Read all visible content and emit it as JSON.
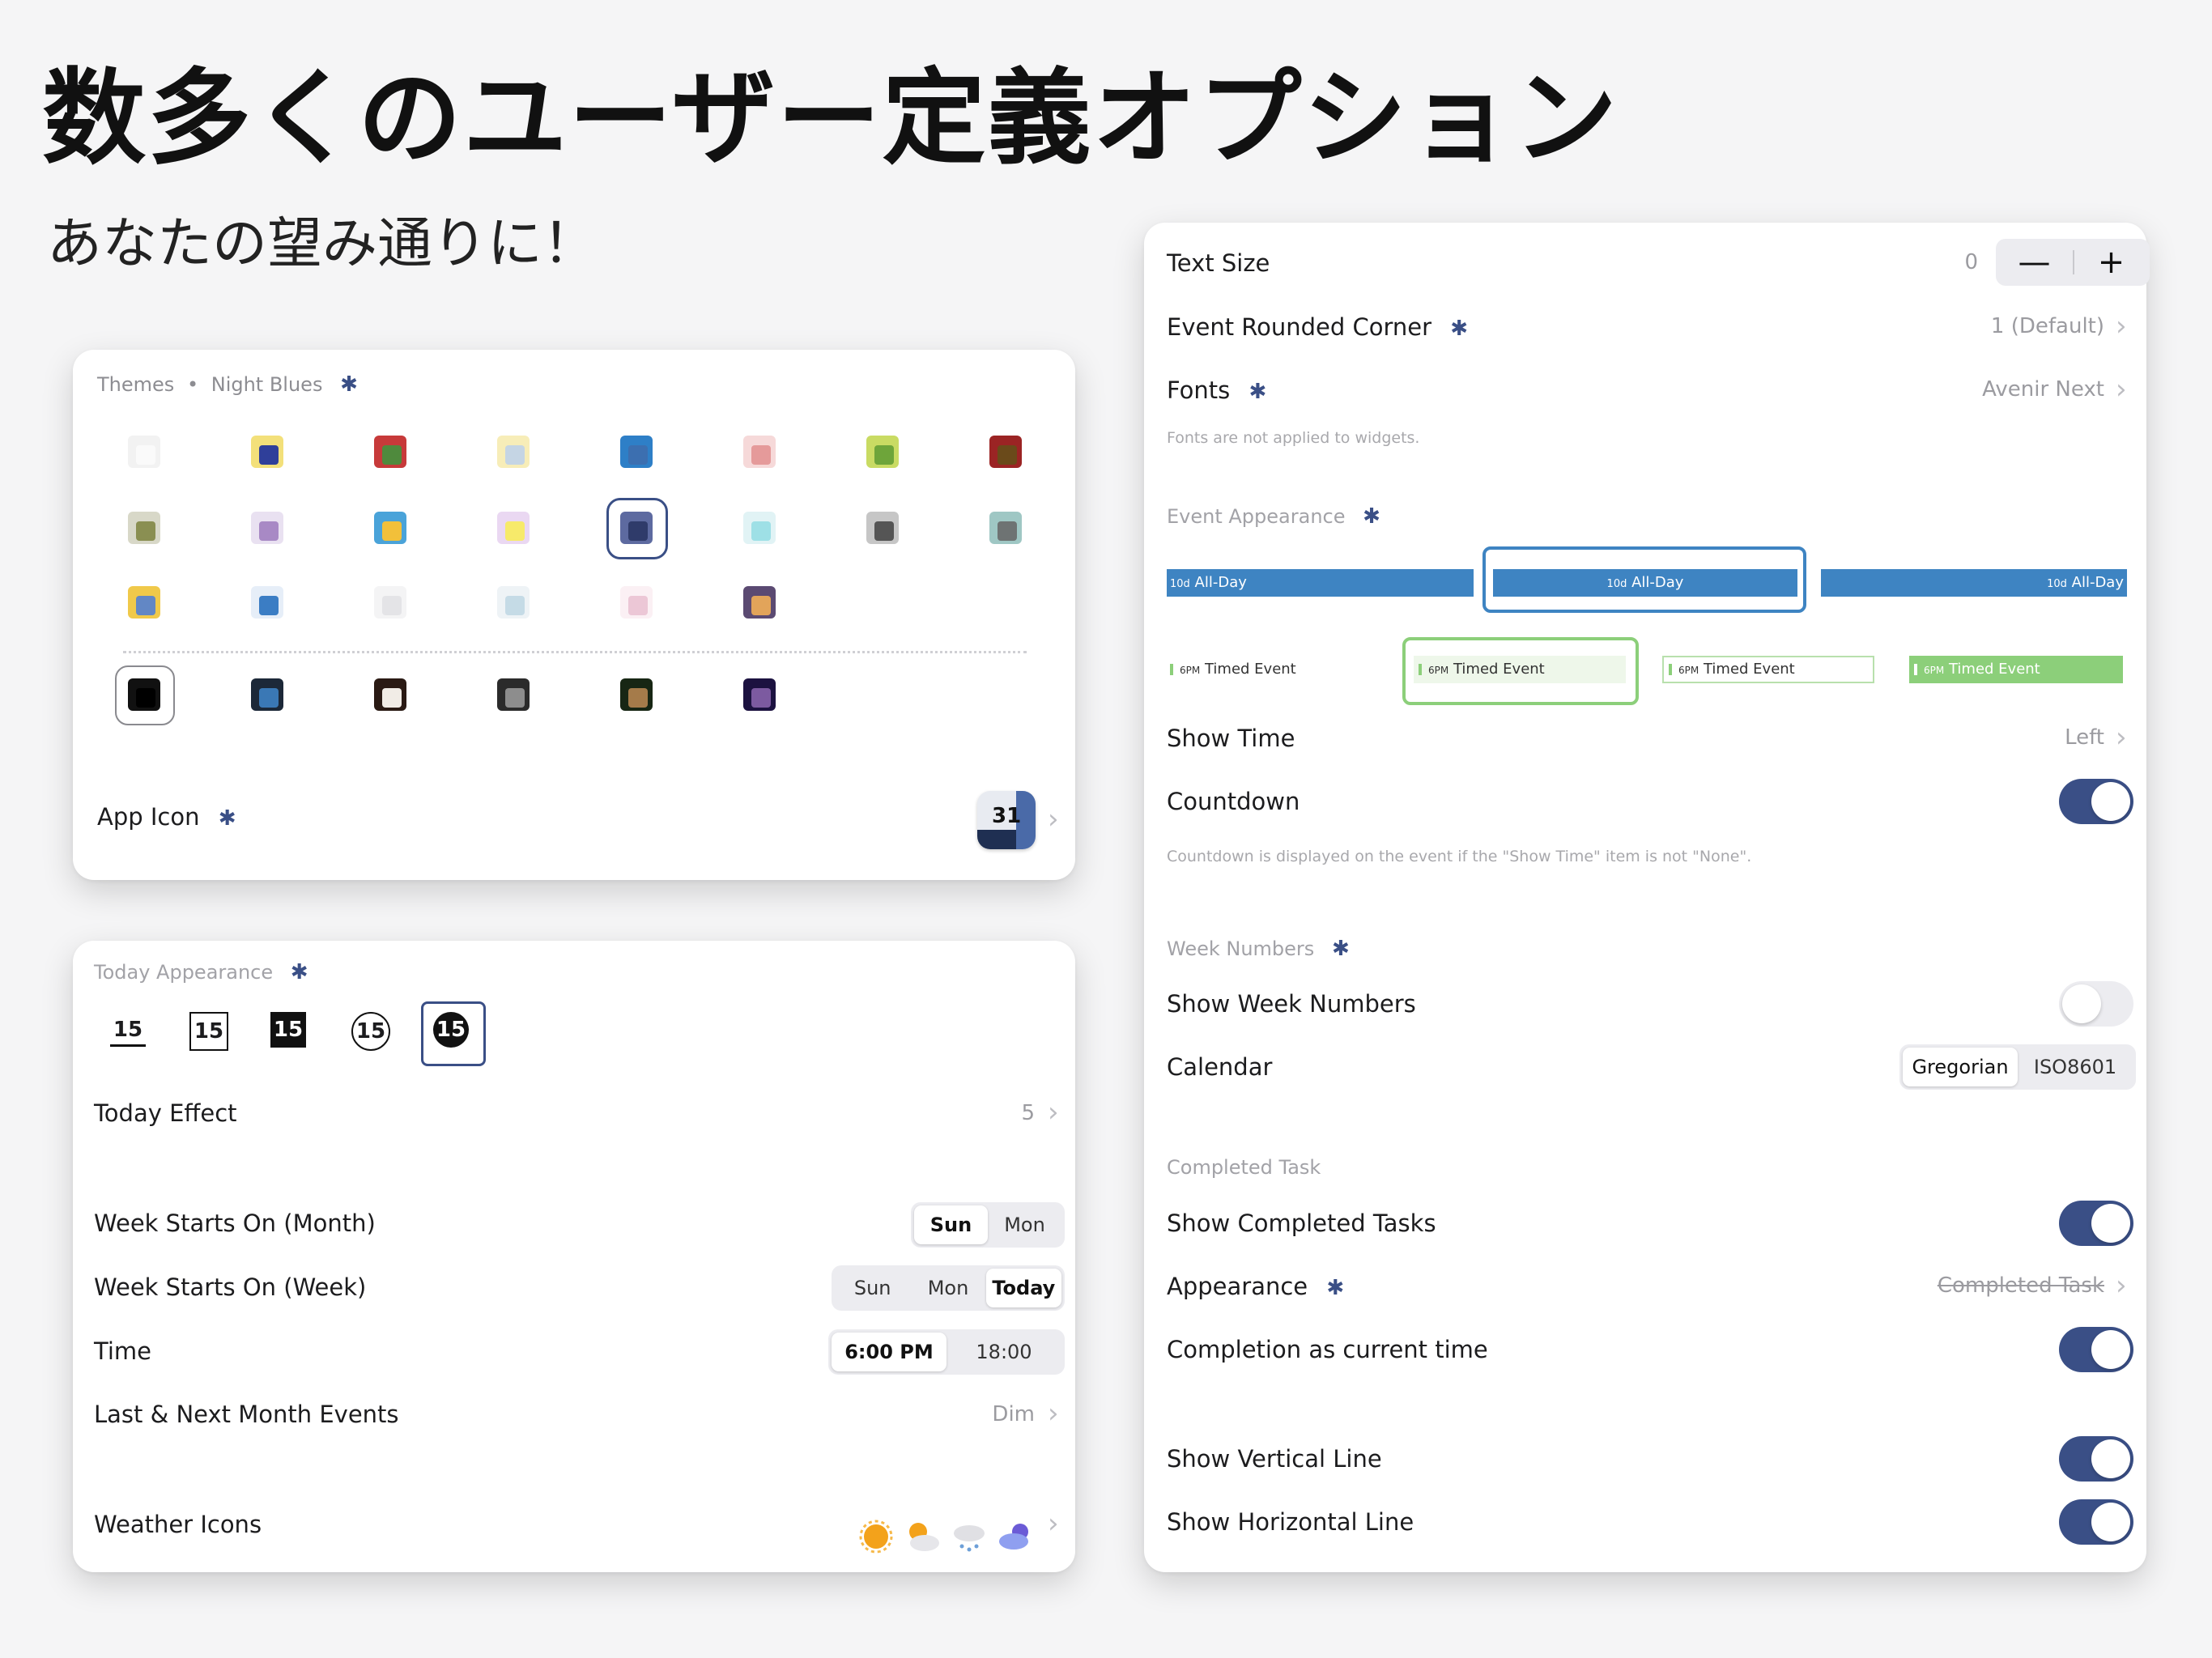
{
  "hero": {
    "title": "数多くのユーザー定義オプション",
    "subtitle": "あなたの望み通りに！"
  },
  "themes_card": {
    "header_label": "Themes",
    "header_dot": "•",
    "header_value": "Night Blues",
    "star": "✱",
    "app_icon_label": "App Icon",
    "app_icon_text": "31",
    "chevron": "›"
  },
  "today_card": {
    "section_label": "Today Appearance",
    "today_number": "15",
    "today_effect_label": "Today Effect",
    "today_effect_value": "5",
    "week_month_label": "Week Starts On (Month)",
    "week_month_options": [
      "Sun",
      "Mon"
    ],
    "week_month_selected": "Sun",
    "week_week_label": "Week Starts On (Week)",
    "week_week_options": [
      "Sun",
      "Mon",
      "Today"
    ],
    "week_week_selected": "Today",
    "time_label": "Time",
    "time_options": [
      "6:00 PM",
      "18:00"
    ],
    "time_selected": "6:00 PM",
    "last_next_label": "Last & Next Month Events",
    "last_next_value": "Dim",
    "weather_label": "Weather Icons",
    "weather_icons": [
      "sun-icon",
      "partly-cloudy-icon",
      "snow-cloud-icon",
      "night-cloud-icon"
    ]
  },
  "right_card": {
    "text_size_label": "Text Size",
    "text_size_value": "0",
    "minus": "—",
    "plus": "+",
    "rounded_label": "Event Rounded Corner",
    "rounded_value": "1 (Default)",
    "fonts_label": "Fonts",
    "fonts_value": "Avenir Next",
    "fonts_note": "Fonts are not applied to widgets.",
    "event_appearance_label": "Event Appearance",
    "allday_prefix": "10d",
    "allday_text": "All-Day",
    "timed_prefix": "6PM",
    "timed_text": "Timed Event",
    "show_time_label": "Show Time",
    "show_time_value": "Left",
    "countdown_label": "Countdown",
    "countdown_on": true,
    "countdown_note": "Countdown is displayed on the event if the \"Show Time\" item is not \"None\".",
    "week_numbers_label": "Week Numbers",
    "show_week_numbers_label": "Show Week Numbers",
    "show_week_numbers_on": false,
    "calendar_label": "Calendar",
    "calendar_options": [
      "Gregorian",
      "ISO8601"
    ],
    "calendar_selected": "Gregorian",
    "completed_section_label": "Completed Task",
    "show_completed_label": "Show Completed Tasks",
    "show_completed_on": true,
    "appearance_label": "Appearance",
    "appearance_value": "Completed Task",
    "completion_label": "Completion as current time",
    "completion_on": true,
    "vertical_line_label": "Show Vertical Line",
    "vertical_line_on": true,
    "horizontal_line_label": "Show Horizontal Line",
    "horizontal_line_on": true
  },
  "colors": {
    "accent": "#3a4f86",
    "allday_blue": "#3e84c2",
    "timed_green": "#8ccf7a"
  }
}
